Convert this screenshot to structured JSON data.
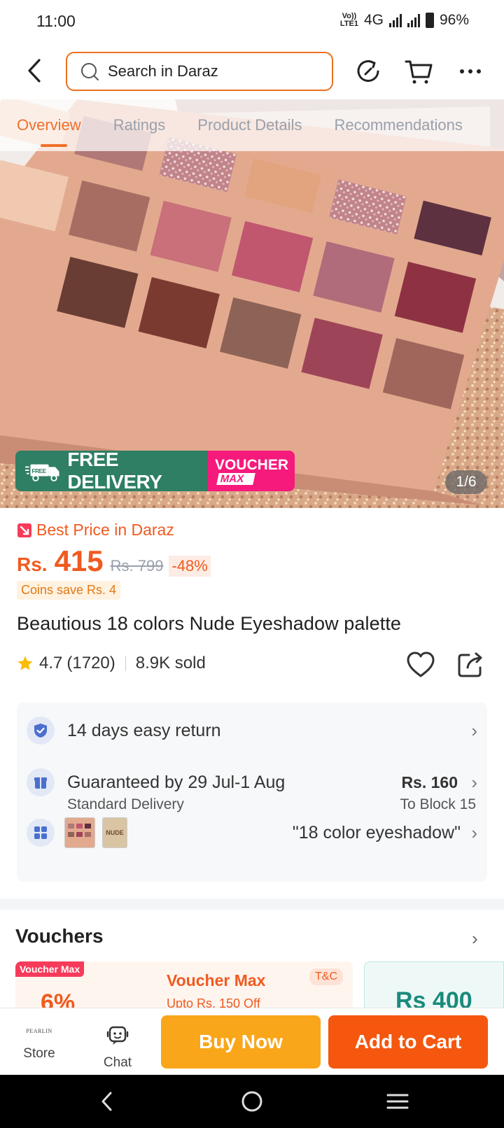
{
  "status": {
    "time": "11:00",
    "volte_top": "Vo))",
    "volte_bottom": "LTE1",
    "network": "4G",
    "battery": "96%"
  },
  "header": {
    "search_placeholder": "Search in Daraz"
  },
  "tabs": [
    "Overview",
    "Ratings",
    "Product Details",
    "Recommendations"
  ],
  "gallery": {
    "counter": "1/6",
    "promo_free": "FREE DELIVERY",
    "promo_free_badge": "FREE",
    "promo_voucher": "VOUCHER",
    "promo_voucher_max": "MAX"
  },
  "pricing": {
    "best_price": "Best Price in Daraz",
    "currency": "Rs.",
    "price": "415",
    "original_price": "Rs. 799",
    "discount": "-48%",
    "coins": "Coins save Rs. 4"
  },
  "product": {
    "title": "Beautious 18 colors Nude Eyeshadow palette",
    "rating": "4.7",
    "rating_count": "(1720)",
    "sold": "8.9K sold"
  },
  "info": {
    "return_policy": "14 days easy return",
    "delivery_guarantee": "Guaranteed by 29 Jul-1 Aug",
    "delivery_type": "Standard Delivery",
    "delivery_price": "Rs. 160",
    "delivery_location": "To Block 15",
    "variant": "\"18 color eyeshadow\"",
    "thumb2_label": "NUDE"
  },
  "vouchers": {
    "title": "Vouchers",
    "badge": "Voucher Max",
    "card1_amount": "6%",
    "card2_title": "Voucher Max",
    "card2_tc": "T&C",
    "card2_sub": "Upto Rs. 150 Off",
    "card3_amount": "Rs 400"
  },
  "actions": {
    "store_logo": "PEARLIN",
    "store": "Store",
    "chat": "Chat",
    "buy_now": "Buy Now",
    "add_to_cart": "Add to Cart"
  },
  "colors": {
    "brand_orange": "#f05a1f",
    "buy_now": "#f9a61a",
    "add_to_cart": "#f5570e",
    "free_delivery": "#2e7f63",
    "voucher_pink": "#f61a7c"
  }
}
